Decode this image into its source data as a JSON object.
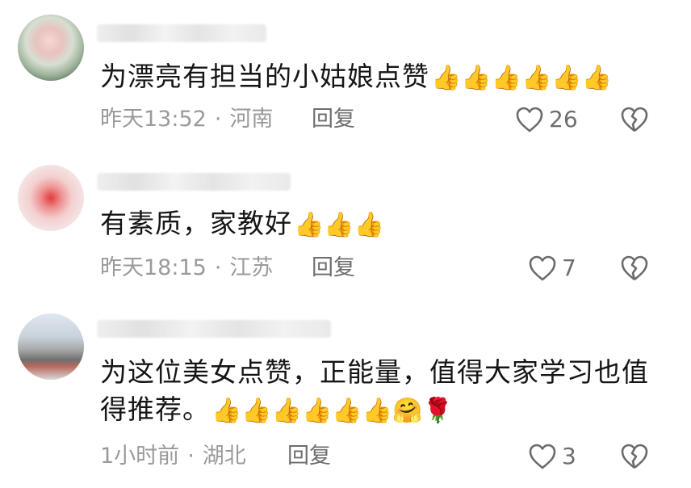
{
  "comments": [
    {
      "text": "为漂亮有担当的小姑娘点赞",
      "emojis": "👍👍👍👍👍👍",
      "time": "昨天13:52",
      "location": "河南",
      "reply": "回复",
      "likes": "26"
    },
    {
      "text": "有素质，家教好",
      "emojis": "👍👍👍",
      "time": "昨天18:15",
      "location": "江苏",
      "reply": "回复",
      "likes": "7"
    },
    {
      "text": "为这位美女点赞，正能量，值得大家学习也值得推荐。",
      "emojis": "👍👍👍👍👍👍🤗🌹",
      "time": "1小时前",
      "location": "湖北",
      "reply": "回复",
      "likes": "3"
    }
  ],
  "separator": "·"
}
